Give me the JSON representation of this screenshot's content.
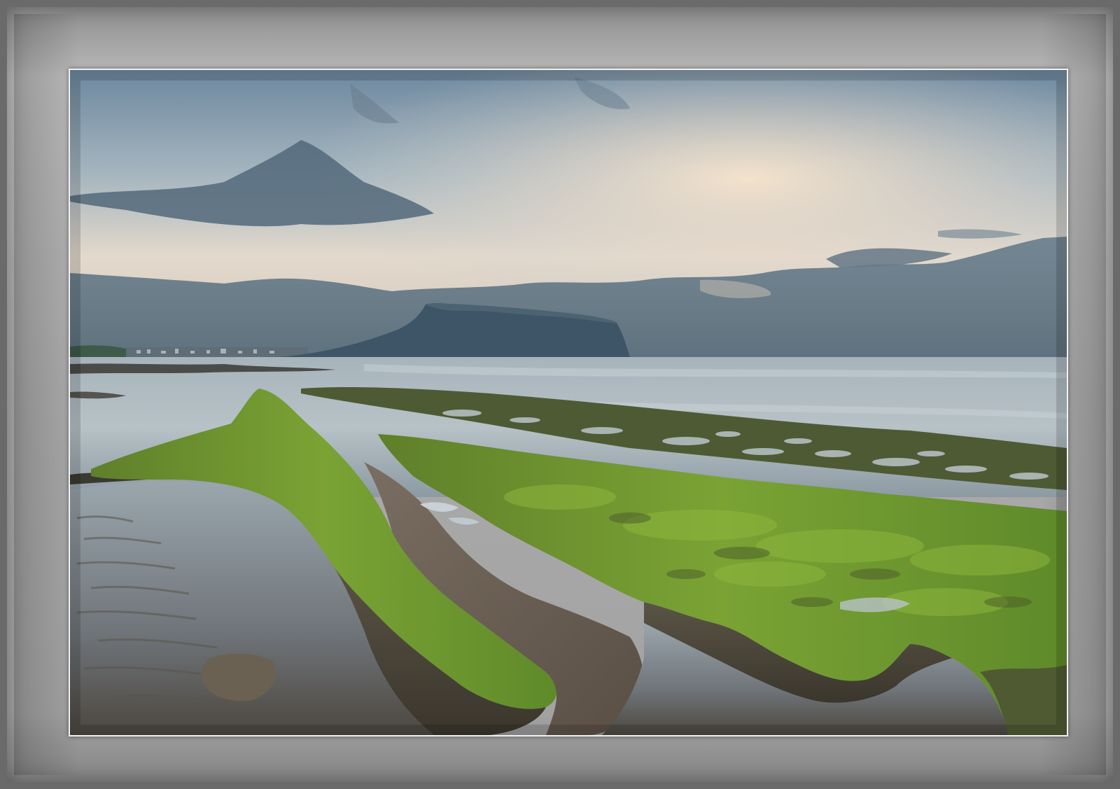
{
  "image": {
    "scene": "coastal-seascape-photo",
    "colors": {
      "frame_outer": "#6a6a6a",
      "mat": "#adadad",
      "photo_border": "#f2f2f2",
      "sky_top": "#6f8aa0",
      "sky_glow": "#f1e2cf",
      "sea": "#a9b7bf",
      "moss": "#6f9a2a",
      "rock": "#4a4538",
      "tidepool": "#8e98a0"
    }
  }
}
